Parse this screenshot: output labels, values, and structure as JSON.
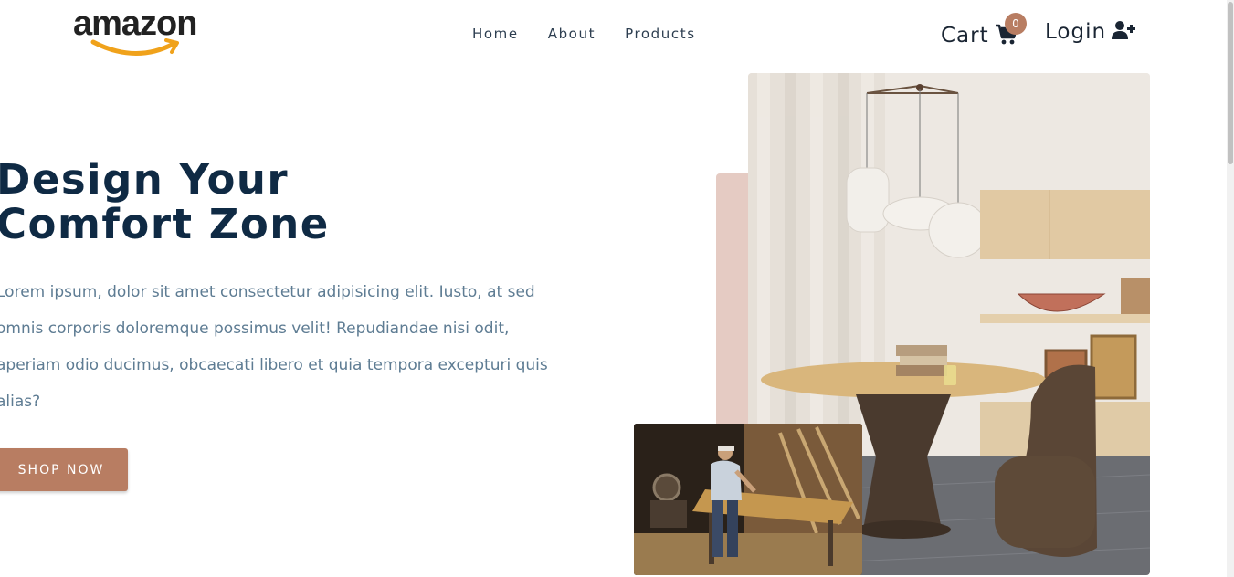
{
  "header": {
    "logo_text": "amazon",
    "nav": [
      {
        "label": "Home"
      },
      {
        "label": "About"
      },
      {
        "label": "Products"
      }
    ],
    "cart_label": "Cart",
    "cart_count": "0",
    "login_label": "Login",
    "icons": {
      "cart": "shopping-cart-icon",
      "login": "user-plus-icon"
    }
  },
  "hero": {
    "title": "Design Your\nComfort Zone",
    "description": "Lorem ipsum, dolor sit amet consectetur adipisicing elit. Iusto, at sed omnis corporis doloremque possimus velit! Repudiandae nisi odit, aperiam odio ducimus, obcaecati libero et quia tempora excepturi quis alias?",
    "cta_label": "SHOP NOW"
  },
  "colors": {
    "accent": "#b87d62",
    "heading": "#0f2a44",
    "body_text": "#5e7c93",
    "accent_block": "#e5cbc3"
  }
}
